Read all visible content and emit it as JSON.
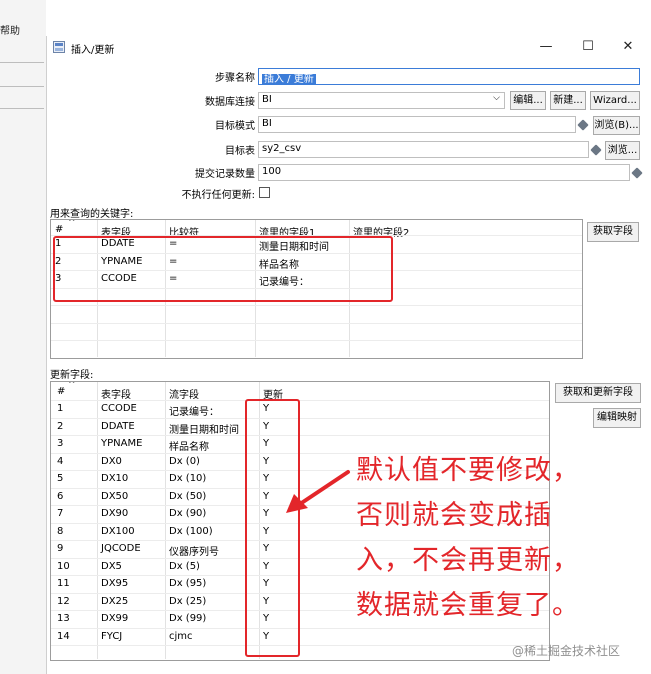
{
  "background_app": {
    "menu_fragment": "帮助"
  },
  "dialog": {
    "title": "插入/更新",
    "controls": {
      "minimize": "—",
      "maximize": "☐",
      "close": "✕"
    }
  },
  "form": {
    "step_name": {
      "label": "步骤名称",
      "value": "插入 / 更新"
    },
    "db_connection": {
      "label": "数据库连接",
      "value": "BI",
      "edit": "编辑...",
      "new": "新建...",
      "wizard": "Wizard..."
    },
    "target_schema": {
      "label": "目标模式",
      "value": "BI",
      "browse": "浏览(B)..."
    },
    "target_table": {
      "label": "目标表",
      "value": "sy2_csv",
      "browse": "浏览..."
    },
    "commit_size": {
      "label": "提交记录数量",
      "value": "100"
    },
    "no_update": {
      "label": "不执行任何更新:",
      "checked": false
    }
  },
  "keys_section": {
    "title": "用来查询的关键字:",
    "get_fields": "获取字段",
    "columns": [
      "#",
      "表字段",
      "比较符",
      "流里的字段1",
      "流里的字段2"
    ],
    "rows": [
      [
        "1",
        "DDATE",
        "=",
        "测量日期和时间",
        ""
      ],
      [
        "2",
        "YPNAME",
        "=",
        "样品名称",
        ""
      ],
      [
        "3",
        "CCODE",
        "=",
        "记录编号：",
        ""
      ]
    ]
  },
  "update_section": {
    "title": "更新字段:",
    "get_update_fields": "获取和更新字段",
    "edit_mapping": "编辑映射",
    "columns": [
      "#",
      "表字段",
      "流字段",
      "更新"
    ],
    "rows": [
      [
        "1",
        "CCODE",
        "记录编号：",
        "Y"
      ],
      [
        "2",
        "DDATE",
        "测量日期和时间",
        "Y"
      ],
      [
        "3",
        "YPNAME",
        "样品名称",
        "Y"
      ],
      [
        "4",
        "DX0",
        "Dx (0)",
        "Y"
      ],
      [
        "5",
        "DX10",
        "Dx (10)",
        "Y"
      ],
      [
        "6",
        "DX50",
        "Dx (50)",
        "Y"
      ],
      [
        "7",
        "DX90",
        "Dx (90)",
        "Y"
      ],
      [
        "8",
        "DX100",
        "Dx (100)",
        "Y"
      ],
      [
        "9",
        "JQCODE",
        "仪器序列号",
        "Y"
      ],
      [
        "10",
        "DX5",
        "Dx (5)",
        "Y"
      ],
      [
        "11",
        "DX95",
        "Dx (95)",
        "Y"
      ],
      [
        "12",
        "DX25",
        "Dx (25)",
        "Y"
      ],
      [
        "13",
        "DX99",
        "Dx (99)",
        "Y"
      ],
      [
        "14",
        "FYCJ",
        "cjmc",
        "Y"
      ]
    ]
  },
  "annotation": {
    "lines": [
      "默认值不要修改，",
      "否则就会变成插",
      "入，不会再更新，",
      "数据就会重复了。"
    ],
    "color": "#e3262a"
  },
  "watermark": "@稀土掘金技术社区"
}
